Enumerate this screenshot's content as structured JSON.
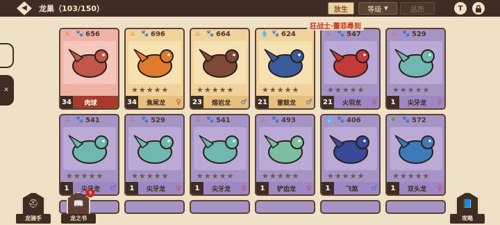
{
  "header": {
    "title": "龙巢（103/150）",
    "release_label": "放生",
    "grade_label": "等级",
    "grade_arrow": "▼",
    "quality_label": "品质",
    "t_icon": "T",
    "lock_icon": "🔒"
  },
  "tooltip": "狂战士·蕾菲尋到",
  "cards": [
    {
      "element": "fire",
      "power": "656",
      "level": "34",
      "name": "肉球",
      "gender": "",
      "rarity": "red",
      "stars": "",
      "marker_color": "#a8392c"
    },
    {
      "element": "fire",
      "power": "696",
      "level": "34",
      "name": "焦尾龙",
      "gender": "♀",
      "rarity": "gold",
      "stars": "★★★★★"
    },
    {
      "element": "fire",
      "power": "664",
      "level": "23",
      "name": "熔岩龙",
      "gender": "♂",
      "rarity": "gold",
      "stars": "★★★★★"
    },
    {
      "element": "water",
      "power": "624",
      "level": "21",
      "name": "雷鼓龙",
      "gender": "♂",
      "rarity": "gold",
      "stars": "★★★★★"
    },
    {
      "element": "fire",
      "power": "547",
      "level": "21",
      "name": "火羽龙",
      "gender": "♀",
      "rarity": "purple",
      "stars": "★★★★★"
    },
    {
      "element": "fire",
      "power": "529",
      "level": "1",
      "name": "尖牙龙",
      "gender": "♀",
      "rarity": "purple",
      "stars": "★★★★★"
    },
    {
      "element": "fire",
      "power": "541",
      "level": "1",
      "name": "尖牙龙",
      "gender": "♂",
      "rarity": "purple",
      "stars": "★★★★★"
    },
    {
      "element": "fire",
      "power": "529",
      "level": "1",
      "name": "尖牙龙",
      "gender": "♀",
      "rarity": "purple",
      "stars": "★★★★★"
    },
    {
      "element": "fire",
      "power": "541",
      "level": "1",
      "name": "尖牙龙",
      "gender": "♀",
      "rarity": "purple",
      "stars": "★★★★★"
    },
    {
      "element": "fire",
      "power": "493",
      "level": "1",
      "name": "铲齿龙",
      "gender": "♀",
      "rarity": "purple",
      "stars": "★★★★★"
    },
    {
      "element": "water",
      "power": "406",
      "level": "1",
      "name": "飞煞",
      "gender": "♂",
      "rarity": "purple",
      "stars": "★★★★★"
    },
    {
      "element": "leaf",
      "power": "572",
      "level": "1",
      "name": "双头龙",
      "gender": "♀",
      "rarity": "purple",
      "stars": "★★★★★"
    }
  ],
  "bottom": {
    "rider_label": "龙骑手",
    "book_label": "龙之书",
    "guide_label": "攻略",
    "badge": "9"
  },
  "colors": {
    "fire": "#d8462c",
    "water": "#3c78c8",
    "leaf": "#4a9a3a"
  }
}
